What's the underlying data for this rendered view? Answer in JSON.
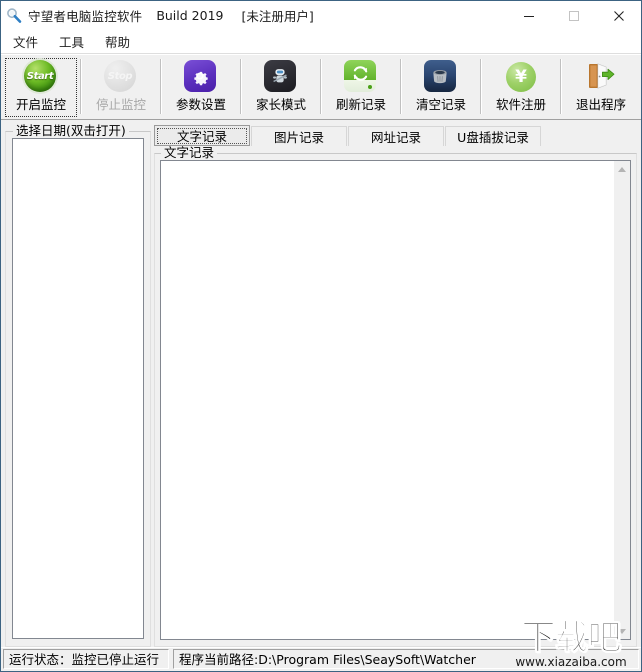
{
  "window": {
    "icon": "magnifier-icon",
    "title": "守望者电脑监控软件",
    "build": "Build 2019",
    "registration": "[未注册用户]",
    "minimize": "—",
    "maximize": "□",
    "close": "✕"
  },
  "menubar": {
    "items": [
      {
        "label": "文件"
      },
      {
        "label": "工具"
      },
      {
        "label": "帮助"
      }
    ]
  },
  "toolbar": {
    "buttons": [
      {
        "label": "开启监控",
        "icon": "start-icon",
        "icon_text": "Start",
        "disabled": false,
        "focused": true
      },
      {
        "label": "停止监控",
        "icon": "stop-icon",
        "icon_text": "Stop",
        "disabled": true,
        "focused": false
      },
      {
        "label": "参数设置",
        "icon": "gear-icon",
        "icon_text": "",
        "disabled": false,
        "focused": false
      },
      {
        "label": "家长模式",
        "icon": "robot-icon",
        "icon_text": "",
        "disabled": false,
        "focused": false
      },
      {
        "label": "刷新记录",
        "icon": "refresh-icon",
        "icon_text": "",
        "disabled": false,
        "focused": false
      },
      {
        "label": "清空记录",
        "icon": "trash-icon",
        "icon_text": "",
        "disabled": false,
        "focused": false
      },
      {
        "label": "软件注册",
        "icon": "yen-icon",
        "icon_text": "¥",
        "disabled": false,
        "focused": false
      },
      {
        "label": "退出程序",
        "icon": "exit-door-icon",
        "icon_text": "",
        "disabled": false,
        "focused": false
      }
    ]
  },
  "left_panel": {
    "group_title": "选择日期(双击打开)",
    "list_items": []
  },
  "tabs": [
    {
      "label": "文字记录",
      "active": true
    },
    {
      "label": "图片记录",
      "active": false
    },
    {
      "label": "网址记录",
      "active": false
    },
    {
      "label": "U盘插拔记录",
      "active": false
    }
  ],
  "record_panel": {
    "group_title": "文字记录",
    "content": "",
    "scroll_up": "scroll-up-arrow",
    "scroll_down": "scroll-down-arrow"
  },
  "statusbar": {
    "run_state": "运行状态：监控已停止运行",
    "path": "程序当前路径:D:\\Program Files\\SeaySoft\\Watcher"
  },
  "watermark": {
    "mark": "下载吧",
    "url": "www.xiazaiba.com"
  }
}
